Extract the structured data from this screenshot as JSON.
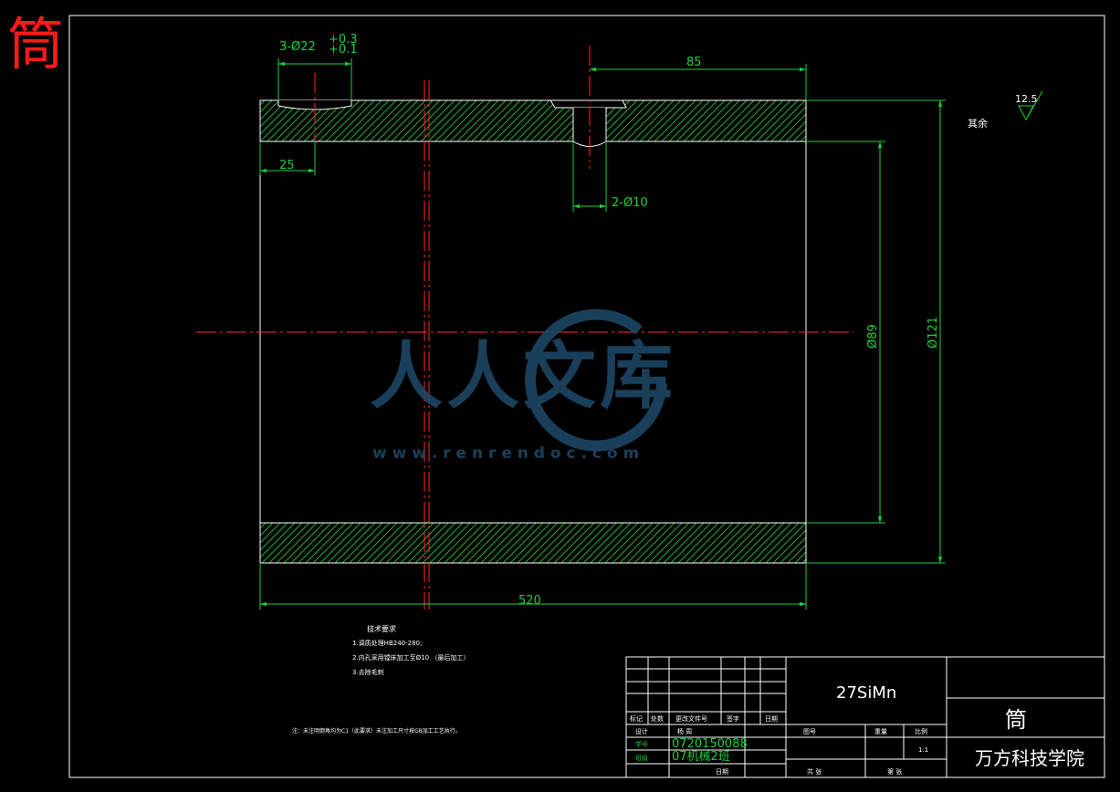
{
  "corner_title": "筒",
  "dimensions": {
    "bore_callout_main": "3-Ø22",
    "bore_callout_upper_tol": "+0.3",
    "bore_callout_lower_tol": "+0.1",
    "overall_length": "520",
    "hole_offset_right": "85",
    "hole_offset_left": "25",
    "small_hole_callout": "2-Ø10",
    "inner_diameter": "Ø89",
    "outer_diameter": "Ø121"
  },
  "roughness": {
    "value": "12.5",
    "remainder_label": "其余"
  },
  "technical_requirements": {
    "title": "技术要求",
    "items": [
      "1.调质处理HB240-280;",
      "2.内孔采用镗床加工至Ø10 （最后加工）",
      "3.去除毛刺"
    ],
    "footnote": "注：未注明倒角均为C1（此要求）未注加工尺寸按GB加工工艺执行。"
  },
  "watermark": {
    "text": "人人文库",
    "url": "w w w . r e n r e n d o c . c o m"
  },
  "title_block": {
    "material": "27SiMn",
    "part_name": "筒",
    "institution": "万方科技学院",
    "scale_label": "比例",
    "scale_value": "1:1",
    "student_id": "0720150088",
    "class_name": "07机械2班",
    "rev_headers": [
      "标记",
      "处数",
      "更改文件号",
      "签字",
      "日期"
    ],
    "row_labels": [
      "设计",
      "学号",
      "班级"
    ],
    "design_value": "杨 周",
    "date_label": "日期",
    "drawing_no_label": "图号",
    "weight_label": "重量",
    "sheet_total_label": "共 张",
    "sheet_label": "第 张"
  }
}
